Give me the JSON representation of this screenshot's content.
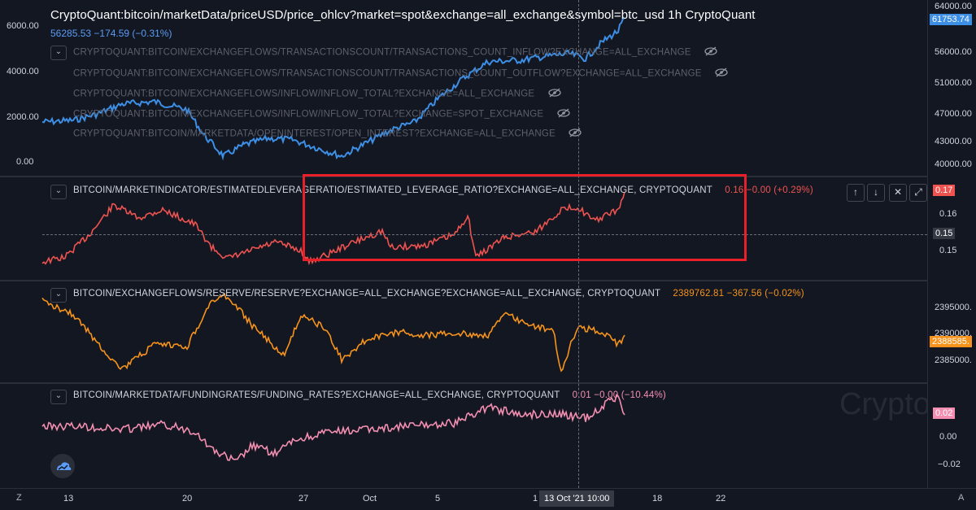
{
  "header": {
    "title": "CryptoQuant:bitcoin/marketData/priceUSD/price_ohlcv?market=spot&exchange=all_exchange&symbol=btc_usd   1h   CryptoQuant",
    "price_line": "56285.53  −174.59 (−0.31%)"
  },
  "overlays": [
    "CRYPTOQUANT:BITCOIN/EXCHANGEFLOWS/TRANSACTIONSCOUNT/TRANSACTIONS_COUNT_INFLOW?EXCHANGE=ALL_EXCHANGE",
    "CRYPTOQUANT:BITCOIN/EXCHANGEFLOWS/TRANSACTIONSCOUNT/TRANSACTIONS_COUNT_OUTFLOW?EXCHANGE=ALL_EXCHANGE",
    "CRYPTOQUANT:BITCOIN/EXCHANGEFLOWS/INFLOW/INFLOW_TOTAL?EXCHANGE=ALL_EXCHANGE",
    "CRYPTOQUANT:BITCOIN/EXCHANGEFLOWS/INFLOW/INFLOW_TOTAL?EXCHANGE=SPOT_EXCHANGE",
    "CRYPTOQUANT:BITCOIN/MARKETDATA/OPENINTEREST/OPEN_INTEREST?EXCHANGE=ALL_EXCHANGE"
  ],
  "panes": {
    "price": {
      "left_ticks": [
        "6000.00",
        "4000.00",
        "2000.00",
        "0.00"
      ],
      "right_ticks": [
        "64000.00",
        "56000.00",
        "51000.00",
        "47000.00",
        "43000.00",
        "40000.00"
      ],
      "last_badge": "61753.74",
      "color": "#3d8fe6"
    },
    "leverage": {
      "label": "BITCOIN/MARKETINDICATOR/ESTIMATEDLEVERAGERATIO/ESTIMATED_LEVERAGE_RATIO?EXCHANGE=ALL_EXCHANGE, CRYPTOQUANT",
      "value": "0.16  −0.00 (+0.29%)",
      "right_ticks": [
        "0.16",
        "0.15"
      ],
      "last_badge": "0.17",
      "cross_badge": "0.15",
      "color": "#ef5350"
    },
    "reserve": {
      "label": "BITCOIN/EXCHANGEFLOWS/RESERVE/RESERVE?EXCHANGE=ALL_EXCHANGE?EXCHANGE=ALL_EXCHANGE, CRYPTOQUANT",
      "value": "2389762.81  −367.56 (−0.02%)",
      "right_ticks": [
        "2395000.",
        "2390000.",
        "2385000."
      ],
      "last_badge": "2388585.",
      "color": "#f7931a"
    },
    "funding": {
      "label": "BITCOIN/MARKETDATA/FUNDINGRATES/FUNDING_RATES?EXCHANGE=ALL_EXCHANGE, CRYPTOQUANT",
      "value": "0.01  −0.00 (−10.44%)",
      "right_ticks": [
        "0.00",
        "−0.02"
      ],
      "last_badge": "0.02",
      "color": "#f48fb1"
    }
  },
  "xaxis": {
    "ticks": [
      "13",
      "20",
      "27",
      "Oct",
      "5",
      "1",
      "18",
      "22"
    ],
    "crosshair_label": "13 Oct '21   10:00",
    "left_corner": "Z",
    "right_corner": "A"
  },
  "watermark": "Crypto",
  "controls": [
    "↑",
    "↓",
    "✕",
    "⤢"
  ]
}
